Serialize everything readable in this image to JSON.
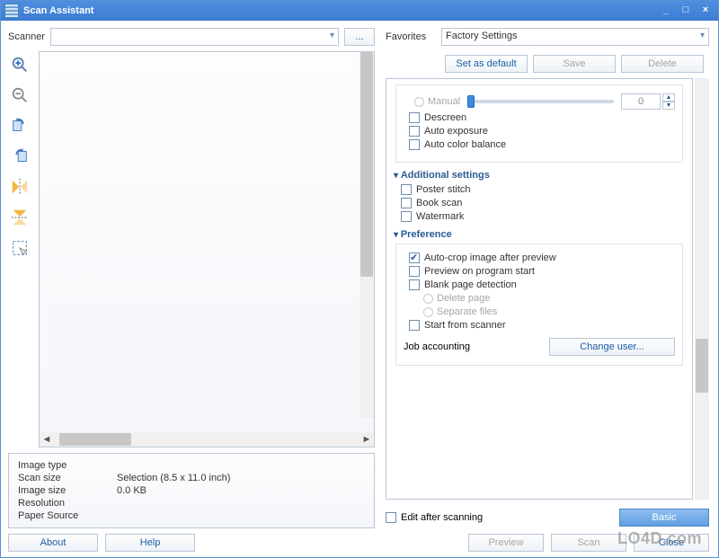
{
  "window": {
    "title": "Scan Assistant"
  },
  "left": {
    "scanner_label": "Scanner",
    "dots": "...",
    "about": "About",
    "help": "Help",
    "info": {
      "image_type_k": "Image type",
      "image_type_v": "",
      "scan_size_k": "Scan size",
      "scan_size_v": "Selection (8.5 x 11.0 inch)",
      "image_size_k": "Image size",
      "image_size_v": "0.0 KB",
      "resolution_k": "Resolution",
      "resolution_v": "",
      "paper_source_k": "Paper Source",
      "paper_source_v": ""
    },
    "tool_names": [
      "zoom-in-icon",
      "zoom-out-icon",
      "rotate-left-icon",
      "rotate-right-icon",
      "mirror-horizontal-icon",
      "mirror-vertical-icon",
      "clear-selection-icon"
    ]
  },
  "right": {
    "favorites_label": "Favorites",
    "favorites_value": "Factory Settings",
    "set_default": "Set as default",
    "save": "Save",
    "delete": "Delete",
    "manual": "Manual",
    "manual_value": "0",
    "descreen": "Descreen",
    "auto_exposure": "Auto exposure",
    "auto_color_balance": "Auto color balance",
    "section_additional": "Additional settings",
    "poster_stitch": "Poster stitch",
    "book_scan": "Book scan",
    "watermark_opt": "Watermark",
    "section_preference": "Preference",
    "auto_crop": "Auto-crop image after preview",
    "preview_on_start": "Preview on program start",
    "blank_page": "Blank page detection",
    "delete_page": "Delete page",
    "separate_files": "Separate files",
    "start_from_scanner": "Start from scanner",
    "job_accounting": "Job accounting",
    "change_user": "Change user...",
    "edit_after": "Edit after scanning",
    "basic": "Basic",
    "preview_btn": "Preview",
    "scan_btn": "Scan",
    "close_btn": "Close"
  },
  "watermark": "LO4D.com"
}
